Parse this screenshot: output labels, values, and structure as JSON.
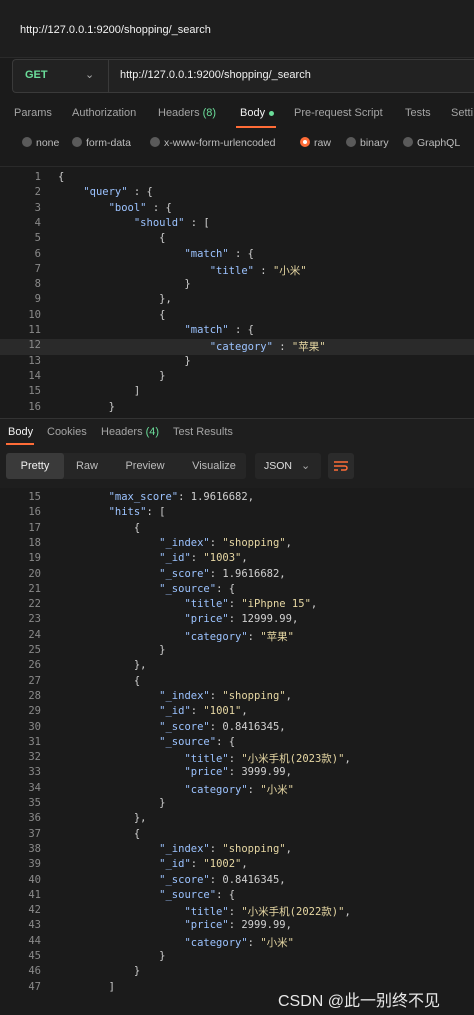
{
  "window": {
    "title": "http://127.0.0.1:9200/shopping/_search"
  },
  "request": {
    "method": "GET",
    "method_chevron": "⌄",
    "url": "http://127.0.0.1:9200/shopping/_search"
  },
  "request_tabs": {
    "params": "Params",
    "authorization": "Authorization",
    "headers": "Headers",
    "headers_count": "(8)",
    "body": "Body",
    "prerequest": "Pre-request Script",
    "tests": "Tests",
    "settings": "Setti"
  },
  "body_modes": {
    "none": "none",
    "form_data": "form-data",
    "urlencoded": "x-www-form-urlencoded",
    "raw": "raw",
    "binary": "binary",
    "graphql": "GraphQL",
    "selected": "raw"
  },
  "editor_lines": [
    {
      "n": "1",
      "t": "{"
    },
    {
      "n": "2",
      "t": "    \"query\" : {"
    },
    {
      "n": "3",
      "t": "        \"bool\" : {"
    },
    {
      "n": "4",
      "t": "            \"should\" : ["
    },
    {
      "n": "5",
      "t": "                {"
    },
    {
      "n": "6",
      "t": "                    \"match\" : {"
    },
    {
      "n": "7",
      "t": "                        \"title\" : \"小米\""
    },
    {
      "n": "8",
      "t": "                    }"
    },
    {
      "n": "9",
      "t": "                },"
    },
    {
      "n": "10",
      "t": "                {"
    },
    {
      "n": "11",
      "t": "                    \"match\" : {"
    },
    {
      "n": "12",
      "t": "                        \"category\" : \"苹果\""
    },
    {
      "n": "13",
      "t": "                    }"
    },
    {
      "n": "14",
      "t": "                }"
    },
    {
      "n": "15",
      "t": "            ]"
    },
    {
      "n": "16",
      "t": "        }"
    }
  ],
  "response_tabs": {
    "body": "Body",
    "cookies": "Cookies",
    "headers": "Headers",
    "headers_count": "(4)",
    "test_results": "Test Results"
  },
  "response_view": {
    "pretty": "Pretty",
    "raw": "Raw",
    "preview": "Preview",
    "visualize": "Visualize",
    "format": "JSON",
    "format_chevron": "⌄"
  },
  "response_lines": [
    {
      "n": "15",
      "t": "        \"max_score\": 1.9616682,"
    },
    {
      "n": "16",
      "t": "        \"hits\": ["
    },
    {
      "n": "17",
      "t": "            {"
    },
    {
      "n": "18",
      "t": "                \"_index\": \"shopping\","
    },
    {
      "n": "19",
      "t": "                \"_id\": \"1003\","
    },
    {
      "n": "20",
      "t": "                \"_score\": 1.9616682,"
    },
    {
      "n": "21",
      "t": "                \"_source\": {"
    },
    {
      "n": "22",
      "t": "                    \"title\": \"iPhpne 15\","
    },
    {
      "n": "23",
      "t": "                    \"price\": 12999.99,"
    },
    {
      "n": "24",
      "t": "                    \"category\": \"苹果\""
    },
    {
      "n": "25",
      "t": "                }"
    },
    {
      "n": "26",
      "t": "            },"
    },
    {
      "n": "27",
      "t": "            {"
    },
    {
      "n": "28",
      "t": "                \"_index\": \"shopping\","
    },
    {
      "n": "29",
      "t": "                \"_id\": \"1001\","
    },
    {
      "n": "30",
      "t": "                \"_score\": 0.8416345,"
    },
    {
      "n": "31",
      "t": "                \"_source\": {"
    },
    {
      "n": "32",
      "t": "                    \"title\": \"小米手机(2023款)\","
    },
    {
      "n": "33",
      "t": "                    \"price\": 3999.99,"
    },
    {
      "n": "34",
      "t": "                    \"category\": \"小米\""
    },
    {
      "n": "35",
      "t": "                }"
    },
    {
      "n": "36",
      "t": "            },"
    },
    {
      "n": "37",
      "t": "            {"
    },
    {
      "n": "38",
      "t": "                \"_index\": \"shopping\","
    },
    {
      "n": "39",
      "t": "                \"_id\": \"1002\","
    },
    {
      "n": "40",
      "t": "                \"_score\": 0.8416345,"
    },
    {
      "n": "41",
      "t": "                \"_source\": {"
    },
    {
      "n": "42",
      "t": "                    \"title\": \"小米手机(2022款)\","
    },
    {
      "n": "43",
      "t": "                    \"price\": 2999.99,"
    },
    {
      "n": "44",
      "t": "                    \"category\": \"小米\""
    },
    {
      "n": "45",
      "t": "                }"
    },
    {
      "n": "46",
      "t": "            }"
    },
    {
      "n": "47",
      "t": "        ]"
    }
  ],
  "watermark": "CSDN @此一别终不见",
  "colors": {
    "accent": "#ff6c37",
    "method_green": "#6bdd9a",
    "key_blue": "#9cc3ff",
    "string_yellow": "#e6d7a3"
  }
}
